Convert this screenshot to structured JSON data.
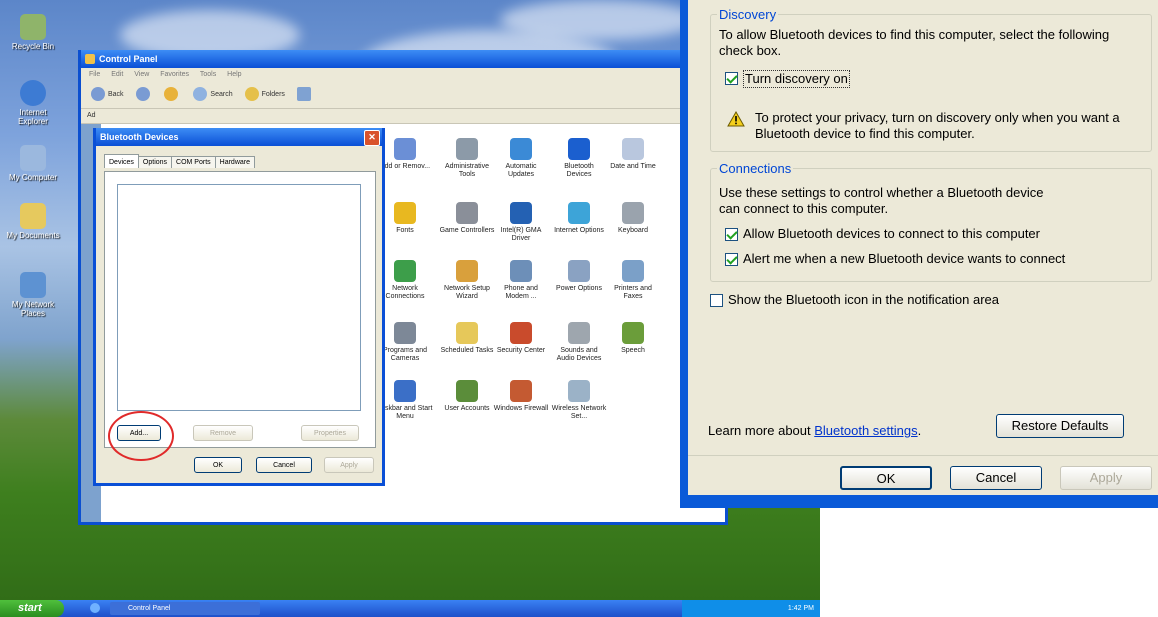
{
  "desktop": {
    "icons": [
      "Recycle Bin",
      "Internet Explorer",
      "My Computer",
      "My Documents",
      "My Network Places"
    ]
  },
  "control_panel": {
    "title": "Control Panel",
    "menu": [
      "File",
      "Edit",
      "View",
      "Favorites",
      "Tools",
      "Help"
    ],
    "toolbar": {
      "back": "Back",
      "search": "Search",
      "folders": "Folders"
    },
    "address_label": "Ad",
    "items": [
      {
        "label": "Add or Remov...",
        "color": "#6b8fd6"
      },
      {
        "label": "Administrative Tools",
        "color": "#8c9aa8"
      },
      {
        "label": "Automatic Updates",
        "color": "#3b8ad6"
      },
      {
        "label": "Bluetooth Devices",
        "color": "#1b5fcf"
      },
      {
        "label": "Date and Time",
        "color": "#b9c7de"
      },
      {
        "label": "Fonts",
        "color": "#e8b820"
      },
      {
        "label": "Game Controllers",
        "color": "#8a8f99"
      },
      {
        "label": "Intel(R) GMA Driver",
        "color": "#2461b3"
      },
      {
        "label": "Internet Options",
        "color": "#3da4d8"
      },
      {
        "label": "Keyboard",
        "color": "#9aa3ad"
      },
      {
        "label": "Network Connections",
        "color": "#3d9e4a"
      },
      {
        "label": "Network Setup Wizard",
        "color": "#d9a03c"
      },
      {
        "label": "Phone and Modem ...",
        "color": "#6d8fb8"
      },
      {
        "label": "Power Options",
        "color": "#8aa2c2"
      },
      {
        "label": "Printers and Faxes",
        "color": "#7ba0c8"
      },
      {
        "label": "Programs and Cameras",
        "color": "#7d8897"
      },
      {
        "label": "Scheduled Tasks",
        "color": "#e6c85a"
      },
      {
        "label": "Security Center",
        "color": "#c94b2c"
      },
      {
        "label": "Sounds and Audio Devices",
        "color": "#9ea6ae"
      },
      {
        "label": "Speech",
        "color": "#6b9d3a"
      },
      {
        "label": "Taskbar and Start Menu",
        "color": "#3b6fc7"
      },
      {
        "label": "User Accounts",
        "color": "#5b8d3a"
      },
      {
        "label": "Windows Firewall",
        "color": "#c45a32"
      },
      {
        "label": "Wireless Network Set...",
        "color": "#9bb2c7"
      }
    ]
  },
  "bt_devices_dialog": {
    "title": "Bluetooth Devices",
    "tabs": [
      "Devices",
      "Options",
      "COM Ports",
      "Hardware"
    ],
    "buttons": {
      "add": "Add...",
      "remove": "Remove",
      "properties": "Properties",
      "ok": "OK",
      "cancel": "Cancel",
      "apply": "Apply"
    }
  },
  "taskbar": {
    "start": "start",
    "task": "Control Panel",
    "time": "1:42 PM"
  },
  "settings": {
    "discovery": {
      "title": "Discovery",
      "description": "To allow Bluetooth devices to find this computer, select the following check box.",
      "checkbox": "Turn discovery on",
      "checkbox_checked": true,
      "warning": "To protect your privacy, turn on discovery only when you want a Bluetooth device to find this computer."
    },
    "connections": {
      "title": "Connections",
      "description": "Use these settings to control whether a Bluetooth device can connect to this computer.",
      "allow": "Allow Bluetooth devices to connect to this computer",
      "allow_checked": true,
      "alert": "Alert me when a new Bluetooth device wants to connect",
      "alert_checked": true
    },
    "show_icon": "Show the Bluetooth icon in the notification area",
    "show_icon_checked": false,
    "learn_more": "Learn more about",
    "learn_link": "Bluetooth settings",
    "learn_end": ".",
    "restore": "Restore Defaults",
    "ok": "OK",
    "cancel": "Cancel",
    "apply": "Apply"
  }
}
